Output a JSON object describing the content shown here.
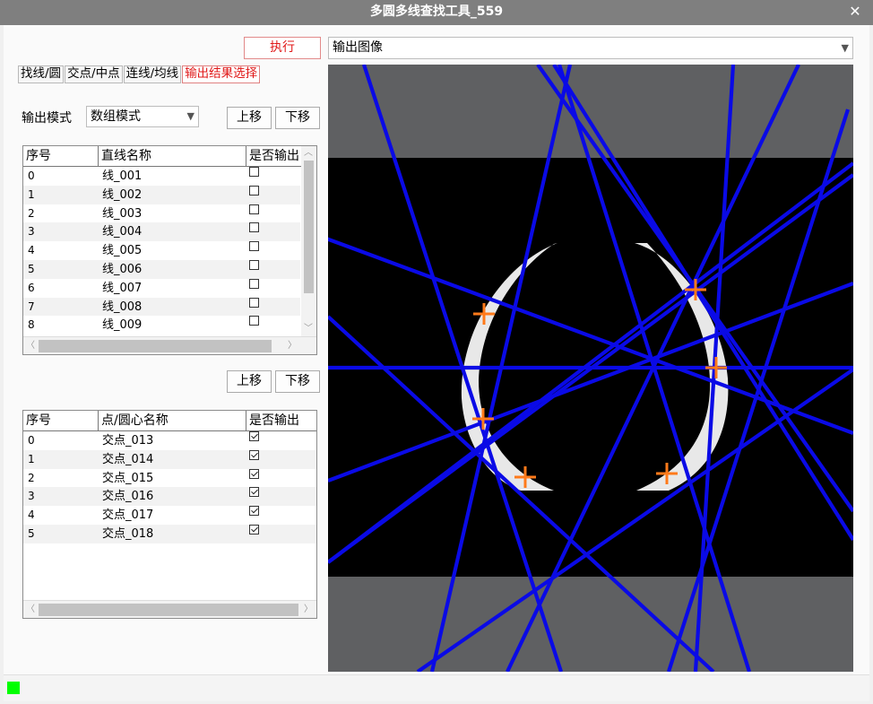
{
  "window": {
    "title": "多圆多线查找工具_559",
    "close_glyph": "✕"
  },
  "toolbar": {
    "run_label": "执行",
    "output_select": "输出图像",
    "dropdown_glyph": "▼"
  },
  "tabs": [
    {
      "label": "找线/圆",
      "active": false
    },
    {
      "label": "交点/中点",
      "active": false
    },
    {
      "label": "连线/均线",
      "active": false
    },
    {
      "label": "输出结果选择",
      "active": true
    }
  ],
  "output_mode": {
    "label": "输出模式",
    "value": "数组模式"
  },
  "move": {
    "up": "上移",
    "down": "下移"
  },
  "lines_table": {
    "headers": [
      "序号",
      "直线名称",
      "是否输出"
    ],
    "rows": [
      {
        "index": "0",
        "name": "线_001",
        "checked": false
      },
      {
        "index": "1",
        "name": "线_002",
        "checked": false
      },
      {
        "index": "2",
        "name": "线_003",
        "checked": false
      },
      {
        "index": "3",
        "name": "线_004",
        "checked": false
      },
      {
        "index": "4",
        "name": "线_005",
        "checked": false
      },
      {
        "index": "5",
        "name": "线_006",
        "checked": false
      },
      {
        "index": "6",
        "name": "线_007",
        "checked": false
      },
      {
        "index": "7",
        "name": "线_008",
        "checked": false
      },
      {
        "index": "8",
        "name": "线_009",
        "checked": false
      }
    ]
  },
  "points_table": {
    "headers": [
      "序号",
      "点/圆心名称",
      "是否输出"
    ],
    "rows": [
      {
        "index": "0",
        "name": "交点_013",
        "checked": true
      },
      {
        "index": "1",
        "name": "交点_014",
        "checked": true
      },
      {
        "index": "2",
        "name": "交点_015",
        "checked": true
      },
      {
        "index": "3",
        "name": "交点_016",
        "checked": true
      },
      {
        "index": "4",
        "name": "交点_017",
        "checked": true
      },
      {
        "index": "5",
        "name": "交点_018",
        "checked": true
      }
    ]
  },
  "image_view": {
    "colors": {
      "background": "#5f6062",
      "band": "#000000",
      "ring": "#e8e8e8",
      "line": "#0a0ae6",
      "marker": "#ff7a1a"
    }
  },
  "status": {
    "indicator_color": "#00ff00"
  }
}
